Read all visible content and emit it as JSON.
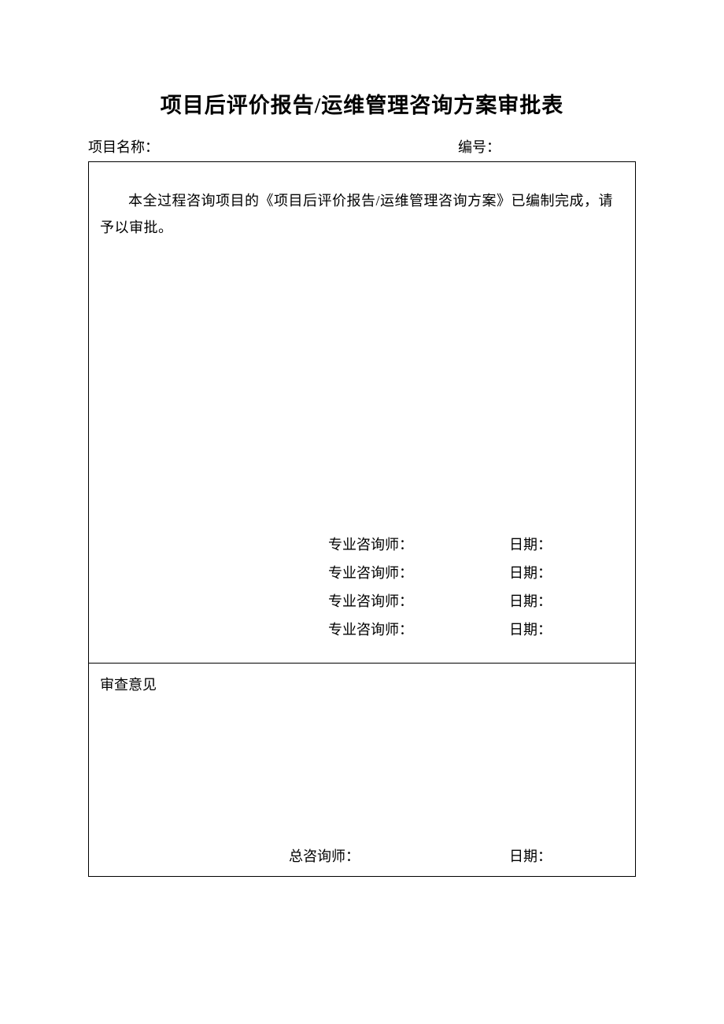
{
  "title": "项目后评价报告/运维管理咨询方案审批表",
  "header": {
    "project_name_label": "项目名称：",
    "number_label": "编号："
  },
  "top_cell": {
    "intro": "本全过程咨询项目的《项目后评价报告/运维管理咨询方案》已编制完成，请予以审批。",
    "signatures": [
      {
        "role": "专业咨询师：",
        "date_label": "日期："
      },
      {
        "role": "专业咨询师：",
        "date_label": "日期："
      },
      {
        "role": "专业咨询师：",
        "date_label": "日期："
      },
      {
        "role": "专业咨询师：",
        "date_label": "日期："
      }
    ]
  },
  "bottom_cell": {
    "review_label": "审查意见",
    "signature": {
      "role": "总咨询师：",
      "date_label": "日期："
    }
  }
}
